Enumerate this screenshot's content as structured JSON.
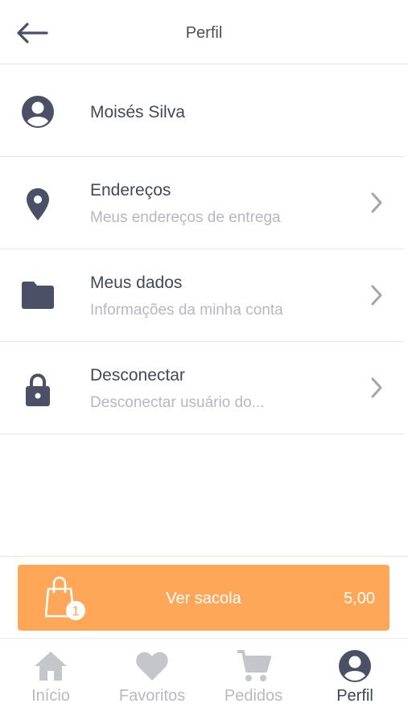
{
  "header": {
    "title": "Perfil",
    "back_icon": "arrow-left-icon"
  },
  "profile": {
    "user_name": "Moisés Silva",
    "items": [
      {
        "icon": "map-pin-icon",
        "title": "Endereços",
        "subtitle": "Meus endereços de entrega"
      },
      {
        "icon": "folder-icon",
        "title": "Meus dados",
        "subtitle": "Informações da minha conta"
      },
      {
        "icon": "lock-icon",
        "title": "Desconectar",
        "subtitle": "Desconectar usuário do..."
      }
    ]
  },
  "bag": {
    "label": "Ver sacola",
    "total": "5,00",
    "count": "1",
    "color": "#fea758"
  },
  "tabs": [
    {
      "label": "Início",
      "icon": "home-icon",
      "active": false
    },
    {
      "label": "Favoritos",
      "icon": "heart-icon",
      "active": false
    },
    {
      "label": "Pedidos",
      "icon": "cart-icon",
      "active": false
    },
    {
      "label": "Perfil",
      "icon": "user-icon",
      "active": true
    }
  ],
  "colors": {
    "icon_dark": "#4c5066",
    "icon_light": "#c4c6cc",
    "text_dark": "#3f4458",
    "text_muted": "#b6b8bf"
  }
}
